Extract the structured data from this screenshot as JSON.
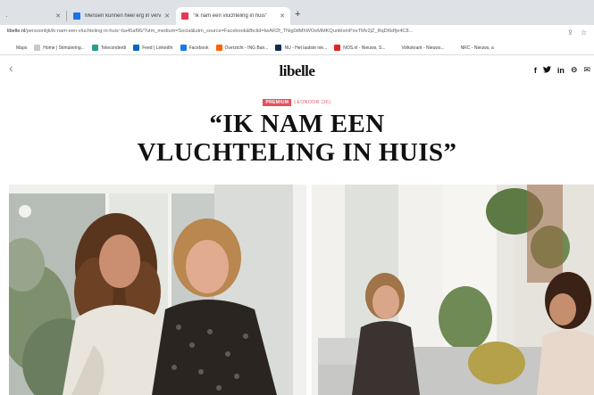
{
  "browser": {
    "tabs": [
      {
        "label": "",
        "favicon_color": "#8ab4f8",
        "active": false
      },
      {
        "label": "Mensen kunnen heel erg in verv",
        "favicon_color": "#1a73e8",
        "active": false
      },
      {
        "label": "\"Ik nam een vluchteling in huis\"",
        "favicon_color": "#e03a55",
        "active": true
      }
    ],
    "new_tab_icon": "plus-icon",
    "address": {
      "host": "libelle.nl",
      "path": "/persoonlijk/ik-nam-een-vluchteling-in-huis~ba45af96/?utm_medium=Social&utm_source=Facebook&fbclid=IwAR2f_TNig0dMhWOeMMKQunbIxmPzeTMv2jZ_RqDI6dfje4C8..."
    },
    "bookmarks": [
      {
        "label": "Maps",
        "icon_color": "#ffffff"
      },
      {
        "label": "Home | Stimulering...",
        "icon_color": "#c9c9c9"
      },
      {
        "label": "Teleconderdi",
        "icon_color": "#2a9d8f"
      },
      {
        "label": "Feed | LinkedIn",
        "icon_color": "#0a66c2"
      },
      {
        "label": "Facebook",
        "icon_color": "#1877f2"
      },
      {
        "label": "Overzicht - ING Ban...",
        "icon_color": "#ff6200"
      },
      {
        "label": "NU - Het laatste nie...",
        "icon_color": "#0a2d4f"
      },
      {
        "label": "NOS.nl - Nieuws, S...",
        "icon_color": "#e1251b"
      },
      {
        "label": "Volkskrant - Nieuws...",
        "icon_color": "#ffffff"
      },
      {
        "label": "NRC - Nieuws, a",
        "icon_color": "#ffffff"
      }
    ]
  },
  "site": {
    "logo": "libelle",
    "back_icon": "chevron-left-icon",
    "share": [
      {
        "name": "facebook",
        "glyph": "f"
      },
      {
        "name": "twitter",
        "glyph": "🐦"
      },
      {
        "name": "linkedin",
        "glyph": "in"
      },
      {
        "name": "link",
        "glyph": "⊖"
      },
      {
        "name": "email",
        "glyph": "✉"
      }
    ]
  },
  "article": {
    "badge": "PREMIUM",
    "author": "LEONOOR (36)",
    "headline_line1": "“IK NAM EEN",
    "headline_line2": "VLUCHTELING IN HUIS”"
  },
  "colors": {
    "accent": "#e8505b",
    "text": "#111111"
  }
}
